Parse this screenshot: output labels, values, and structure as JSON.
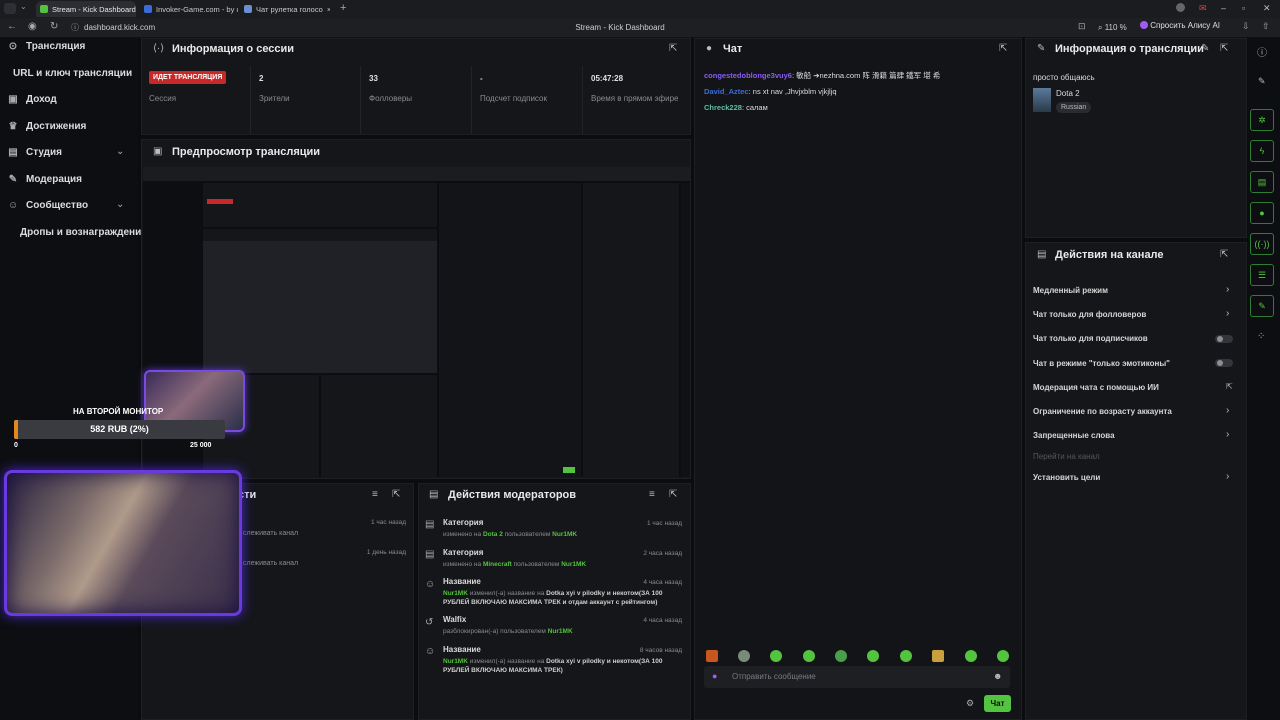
{
  "browser": {
    "tabs": [
      {
        "label": "Stream - Kick Dashboard",
        "color": "#53c43f"
      },
      {
        "label": "Invoker-Game.com - by ci",
        "color": "#3b6bd6"
      },
      {
        "label": "Чат рулетка голосо",
        "color": "#6a8fd0"
      }
    ],
    "url": "dashboard.kick.com",
    "page_title": "Stream - Kick Dashboard",
    "zoom": "110 %",
    "ask_alice": "Спросить Алису AI"
  },
  "nav": {
    "items": [
      {
        "label": "Трансляция",
        "icon": "broadcast-icon"
      },
      {
        "label": "URL и ключ трансляции",
        "icon": ""
      },
      {
        "label": "Доход",
        "icon": "money-icon"
      },
      {
        "label": "Достижения",
        "icon": "trophy-icon"
      },
      {
        "label": "Студия",
        "icon": "studio-icon"
      },
      {
        "label": "Модерация",
        "icon": "wrench-icon"
      },
      {
        "label": "Сообщество",
        "icon": "people-icon"
      },
      {
        "label": "Дропы и вознаграждение",
        "icon": ""
      }
    ]
  },
  "session": {
    "title": "Информация о сессии",
    "stats": [
      {
        "value": "ИДЕТ ТРАНСЛЯЦИЯ",
        "label": "Сессия"
      },
      {
        "value": "2",
        "label": "Зрители"
      },
      {
        "value": "33",
        "label": "Фолловеры"
      },
      {
        "value": "-",
        "label": "Подсчет подписок"
      },
      {
        "value": "05:47:28",
        "label": "Время в прямом эфире"
      }
    ]
  },
  "preview": {
    "title": "Предпросмотр трансляции",
    "overlay_label": "НА ВТОРОЙ МОНИТОР",
    "goal_text": "582 RUB (2%)",
    "goal_min": "0",
    "goal_max": "25 000",
    "goal_progress": 0.02
  },
  "recent": {
    "title": "сти",
    "items": [
      {
        "text": "слеживать канал",
        "time": "1 час назад"
      },
      {
        "text": "слеживать канал",
        "time": "1 день назад"
      }
    ]
  },
  "mod_actions": {
    "title": "Действия модераторов",
    "rows": [
      {
        "title": "Категория",
        "desc": "изменено на",
        "hl1": "Dota 2",
        "mid": "пользователем",
        "hl2": "Nur1MK",
        "time": "1 час назад",
        "icon": "category-icon"
      },
      {
        "title": "Категория",
        "desc": "изменено на",
        "hl1": "Minecraft",
        "mid": "пользователем",
        "hl2": "Nur1MK",
        "time": "2 часа назад",
        "icon": "category-icon"
      },
      {
        "title": "Название",
        "user": "Nur1MK",
        "desc": "изменил(-а) название на",
        "newname": "Dotka xyi v pilodky и некотом(ЗА 100 РУБЛЕЙ ВКЛЮЧАЮ МАКСИМА ТРЕК и отдам аккаунт с рейтингом)",
        "time": "4 часа назад",
        "icon": "user-edit-icon"
      },
      {
        "title": "Walfix",
        "desc": "разблокирован(-а) пользователем",
        "hl2": "Nur1MK",
        "time": "4 часа назад",
        "icon": "undo-icon"
      },
      {
        "title": "Название",
        "user": "Nur1MK",
        "desc": "изменил(-а) название на",
        "newname": "Dotka xyi v pilodky и некотом(ЗА 100 РУБЛЕЙ ВКЛЮЧАЮ МАКСИМА ТРЕК)",
        "time": "8 часов назад",
        "icon": "user-edit-icon"
      }
    ]
  },
  "chat": {
    "title": "Чат",
    "messages": [
      {
        "user": "congestedoblonge3vuy6",
        "color": "#8a5cf6",
        "text": "敏船 ➔nezhna.com 阵 滑籍 篇肆 鐵军 堪 希"
      },
      {
        "user": "David_Aztec",
        "color": "#3b6bd6",
        "text": "ns xt nav ,Jhvjxblm vjkjljq"
      },
      {
        "user": "Chreck228",
        "color": "#5fbfa0",
        "text": "салам"
      }
    ],
    "placeholder": "Отправить сообщение",
    "send_label": "Чат"
  },
  "stream_info": {
    "title": "Информация о трансляции",
    "stream_title": "просто общаюсь",
    "category": "Dota 2",
    "language": "Russian"
  },
  "channel_actions": {
    "title": "Действия на канале",
    "items": [
      {
        "label": "Медленный режим",
        "control": "chevron"
      },
      {
        "label": "Чат только для фолловеров",
        "control": "chevron"
      },
      {
        "label": "Чат только для подписчиков",
        "control": "toggle"
      },
      {
        "label": "Чат в режиме \"только эмотиконы\"",
        "control": "toggle"
      },
      {
        "label": "Модерация чата с помощью ИИ",
        "control": "external"
      },
      {
        "label": "Ограничение по возрасту аккаунта",
        "control": "chevron"
      },
      {
        "label": "Запрещенные слова",
        "control": "chevron"
      },
      {
        "label": "Перейти на канал",
        "control": "none"
      },
      {
        "label": "Установить цели",
        "control": "chevron"
      }
    ]
  },
  "colors": {
    "accent": "#53c43f",
    "live": "#c72828"
  }
}
